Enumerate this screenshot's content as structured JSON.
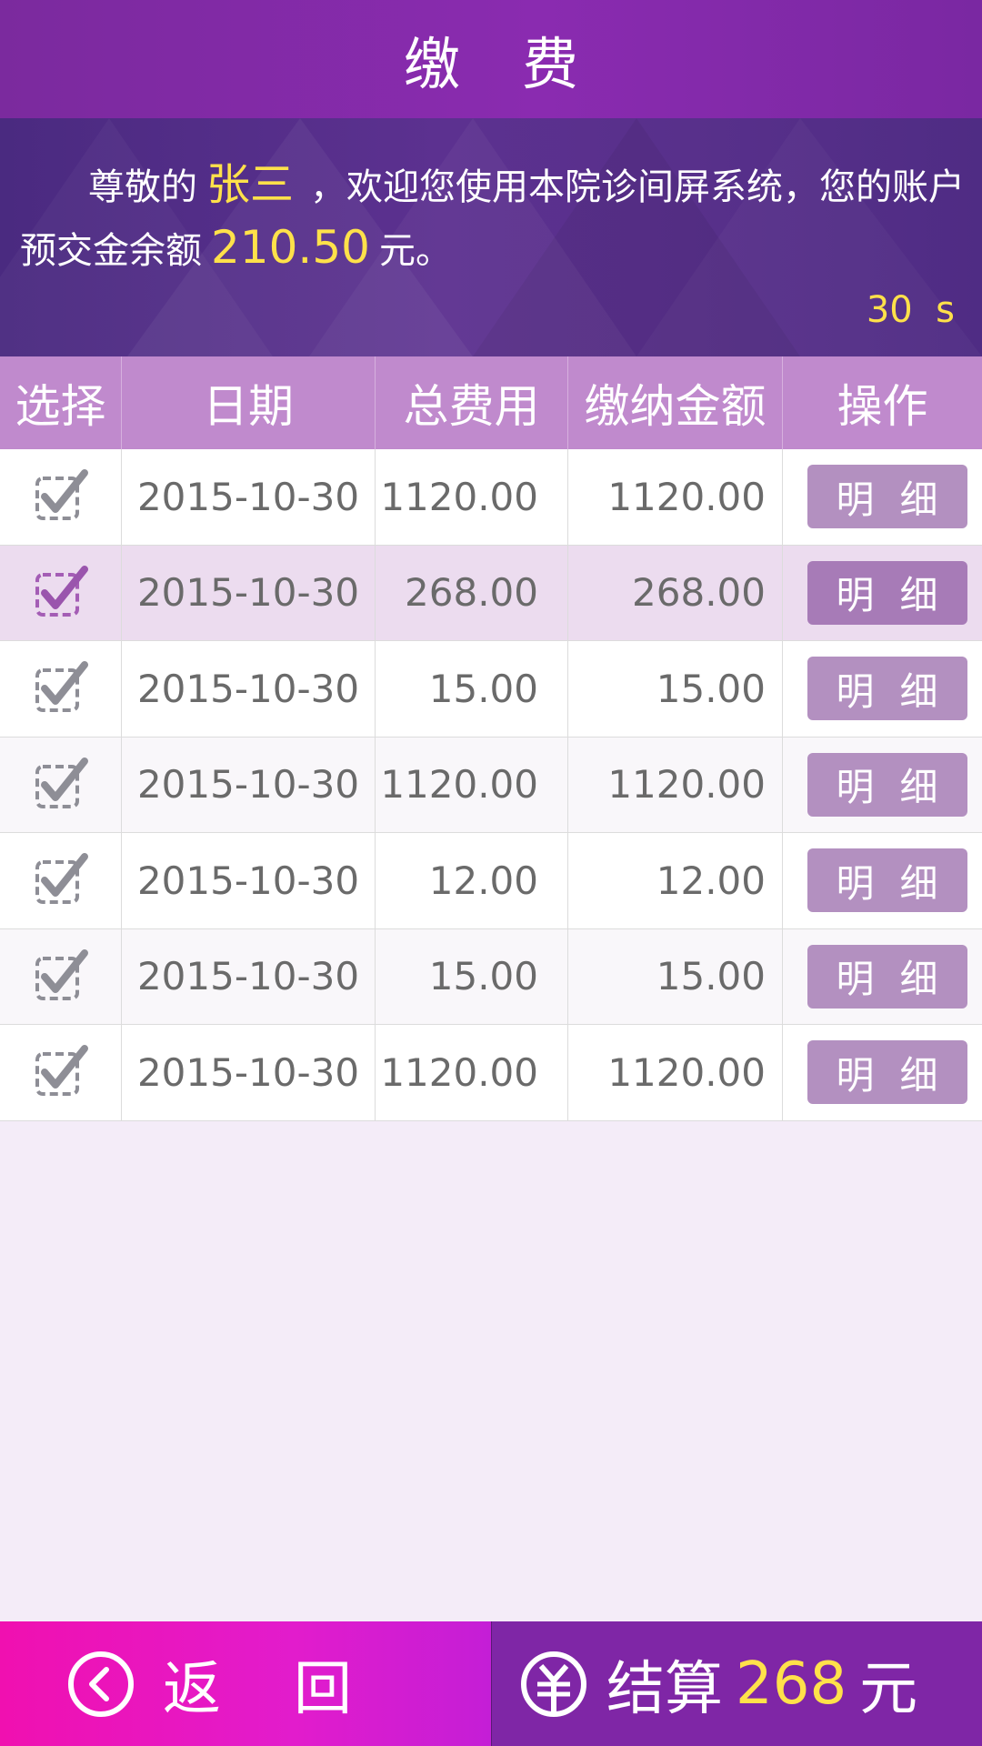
{
  "header": {
    "title": "缴费"
  },
  "banner": {
    "greeting_prefix": "尊敬的",
    "patient_name": "张三",
    "message_middle": "，欢迎您使用本院诊间屏系统，您的账户预交金余额",
    "balance": "210.50",
    "message_suffix": "元。",
    "countdown": "30  s"
  },
  "table": {
    "columns": [
      "选择",
      "日期",
      "总费用",
      "缴纳金额",
      "操作"
    ],
    "detail_label": "明细",
    "rows": [
      {
        "checked": true,
        "date": "2015-10-30",
        "total": "1120.00",
        "paid": "1120.00",
        "highlighted": false
      },
      {
        "checked": true,
        "date": "2015-10-30",
        "total": "268.00",
        "paid": "268.00",
        "highlighted": true
      },
      {
        "checked": true,
        "date": "2015-10-30",
        "total": "15.00",
        "paid": "15.00",
        "highlighted": false
      },
      {
        "checked": true,
        "date": "2015-10-30",
        "total": "1120.00",
        "paid": "1120.00",
        "highlighted": false
      },
      {
        "checked": true,
        "date": "2015-10-30",
        "total": "12.00",
        "paid": "12.00",
        "highlighted": false
      },
      {
        "checked": true,
        "date": "2015-10-30",
        "total": "15.00",
        "paid": "15.00",
        "highlighted": false
      },
      {
        "checked": true,
        "date": "2015-10-30",
        "total": "1120.00",
        "paid": "1120.00",
        "highlighted": false
      }
    ]
  },
  "footer": {
    "back_label": "返回",
    "settle_label": "结算",
    "settle_amount": "268",
    "settle_unit": "元"
  },
  "colors": {
    "accent_purple": "#8a2bb0",
    "highlight_yellow": "#ffe14a",
    "back_pink": "#f010b0",
    "checkbox_normal": "#8e8e96",
    "checkbox_selected": "#a45db5"
  },
  "icons": {
    "checkbox": "checkbox-checked-icon",
    "back": "chevron-left-circle-icon",
    "settle": "yuan-circle-icon"
  }
}
